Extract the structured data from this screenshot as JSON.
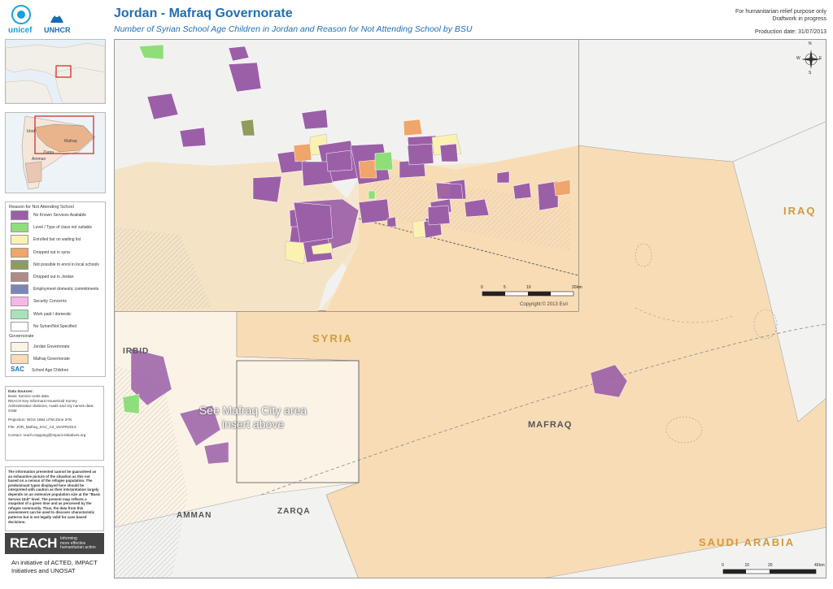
{
  "header": {
    "logo_unicef": "unicef",
    "logo_unhcr": "UNHCR",
    "title": "Jordan - Mafraq Governorate",
    "subtitle": "Number of Syrian School Age Children in Jordan and Reason for Not Attending School by BSU",
    "note_line1": "For humanitarian relief purpose only",
    "note_line2": "Draftwork in progress",
    "production_date": "Production date: 31/07/2013"
  },
  "inset_locator": {
    "label_mafraq": "Mafraq",
    "label_amman": "Amman",
    "label_zarqa": "Zarqa",
    "label_irbid": "Irbid"
  },
  "legend": {
    "title": "Reason for Not Attending School",
    "items": [
      {
        "label": "No Known Services Available",
        "color": "#9b5fa8"
      },
      {
        "label": "Level / Type of class not suitable",
        "color": "#8ede7a"
      },
      {
        "label": "Enrolled but on waiting list",
        "color": "#fbf2b2"
      },
      {
        "label": "Dropped out in syria",
        "color": "#f0a56a"
      },
      {
        "label": "Not possible to enrol in local schools",
        "color": "#8e9c5c"
      },
      {
        "label": "Dropped out in Jordan",
        "color": "#b08b86"
      },
      {
        "label": "Employment domestic commitments",
        "color": "#7b86b8"
      },
      {
        "label": "Security Concerns",
        "color": "#f5b6e8"
      },
      {
        "label": "Work paid / domestic",
        "color": "#a6e3b9"
      },
      {
        "label": "No Syrian/Not Specified",
        "color": "#ffffff"
      }
    ],
    "gov_title": "Governorate",
    "gov_items": [
      {
        "label": "Jordan Governorate",
        "color": "#fbf4e6"
      },
      {
        "label": "Mafraq Governorate",
        "color": "#f8dcb6"
      }
    ],
    "sac_abbrev": "SAC",
    "sac_label": "School Age Children"
  },
  "sources": {
    "heading": "Data Sources:",
    "line1": "Basic Service Units data",
    "line2": "REACH Key Informant Household Survey",
    "line3": "Administrative divisions, roads and city names data:",
    "line4": "OSM",
    "projection": "Projection: WGS 1984 UTM Zone 37N",
    "file": "File: JOR_Mafraq_SAC_A3_15APR2013",
    "contact": "Contact: reach.mapping@impact-initiatives.org"
  },
  "disclaimer": "The information presented cannot be guaranteed as an exhaustive picture of the situation as this not based on a census of the refugee population. The predominant types displayed here should be interpreted with caution as their interpretation largely depends on an extensive population size at the \"Basic Service Unit\" level. The present map reflects a snapshot of a given time and as perceived by the refugee community. Thus, the data from this assessment can be used to discover characteristic patterns but is not legally valid for case based decisions.",
  "reach": {
    "logo": "REACH",
    "tag1": "Informing",
    "tag2": "more effective",
    "tag3": "humanitarian action",
    "initiative1": "An initiative of ACTED, IMPACT",
    "initiative2": "Initiatives and UNOSAT"
  },
  "map": {
    "label_iraq": "IRAQ",
    "label_syria": "SYRIA",
    "label_mafraq": "MAFRAQ",
    "label_saudi": "SAUDI ARABIA",
    "label_amman": "AMMAN",
    "label_zarqa": "ZARQA",
    "label_irbid": "IRBID",
    "insert_note_1": "See Mafraq City area",
    "insert_note_2": "insert above",
    "copyright": "Copyright:© 2013 Esri",
    "compass_n": "N",
    "compass_s": "S",
    "compass_e": "E",
    "compass_w": "W",
    "inset_scale_ticks": [
      "0",
      "5",
      "10",
      "20"
    ],
    "inset_scale_unit": "km",
    "main_scale_ticks": [
      "0",
      "10",
      "20",
      "40"
    ],
    "main_scale_unit": "km"
  }
}
